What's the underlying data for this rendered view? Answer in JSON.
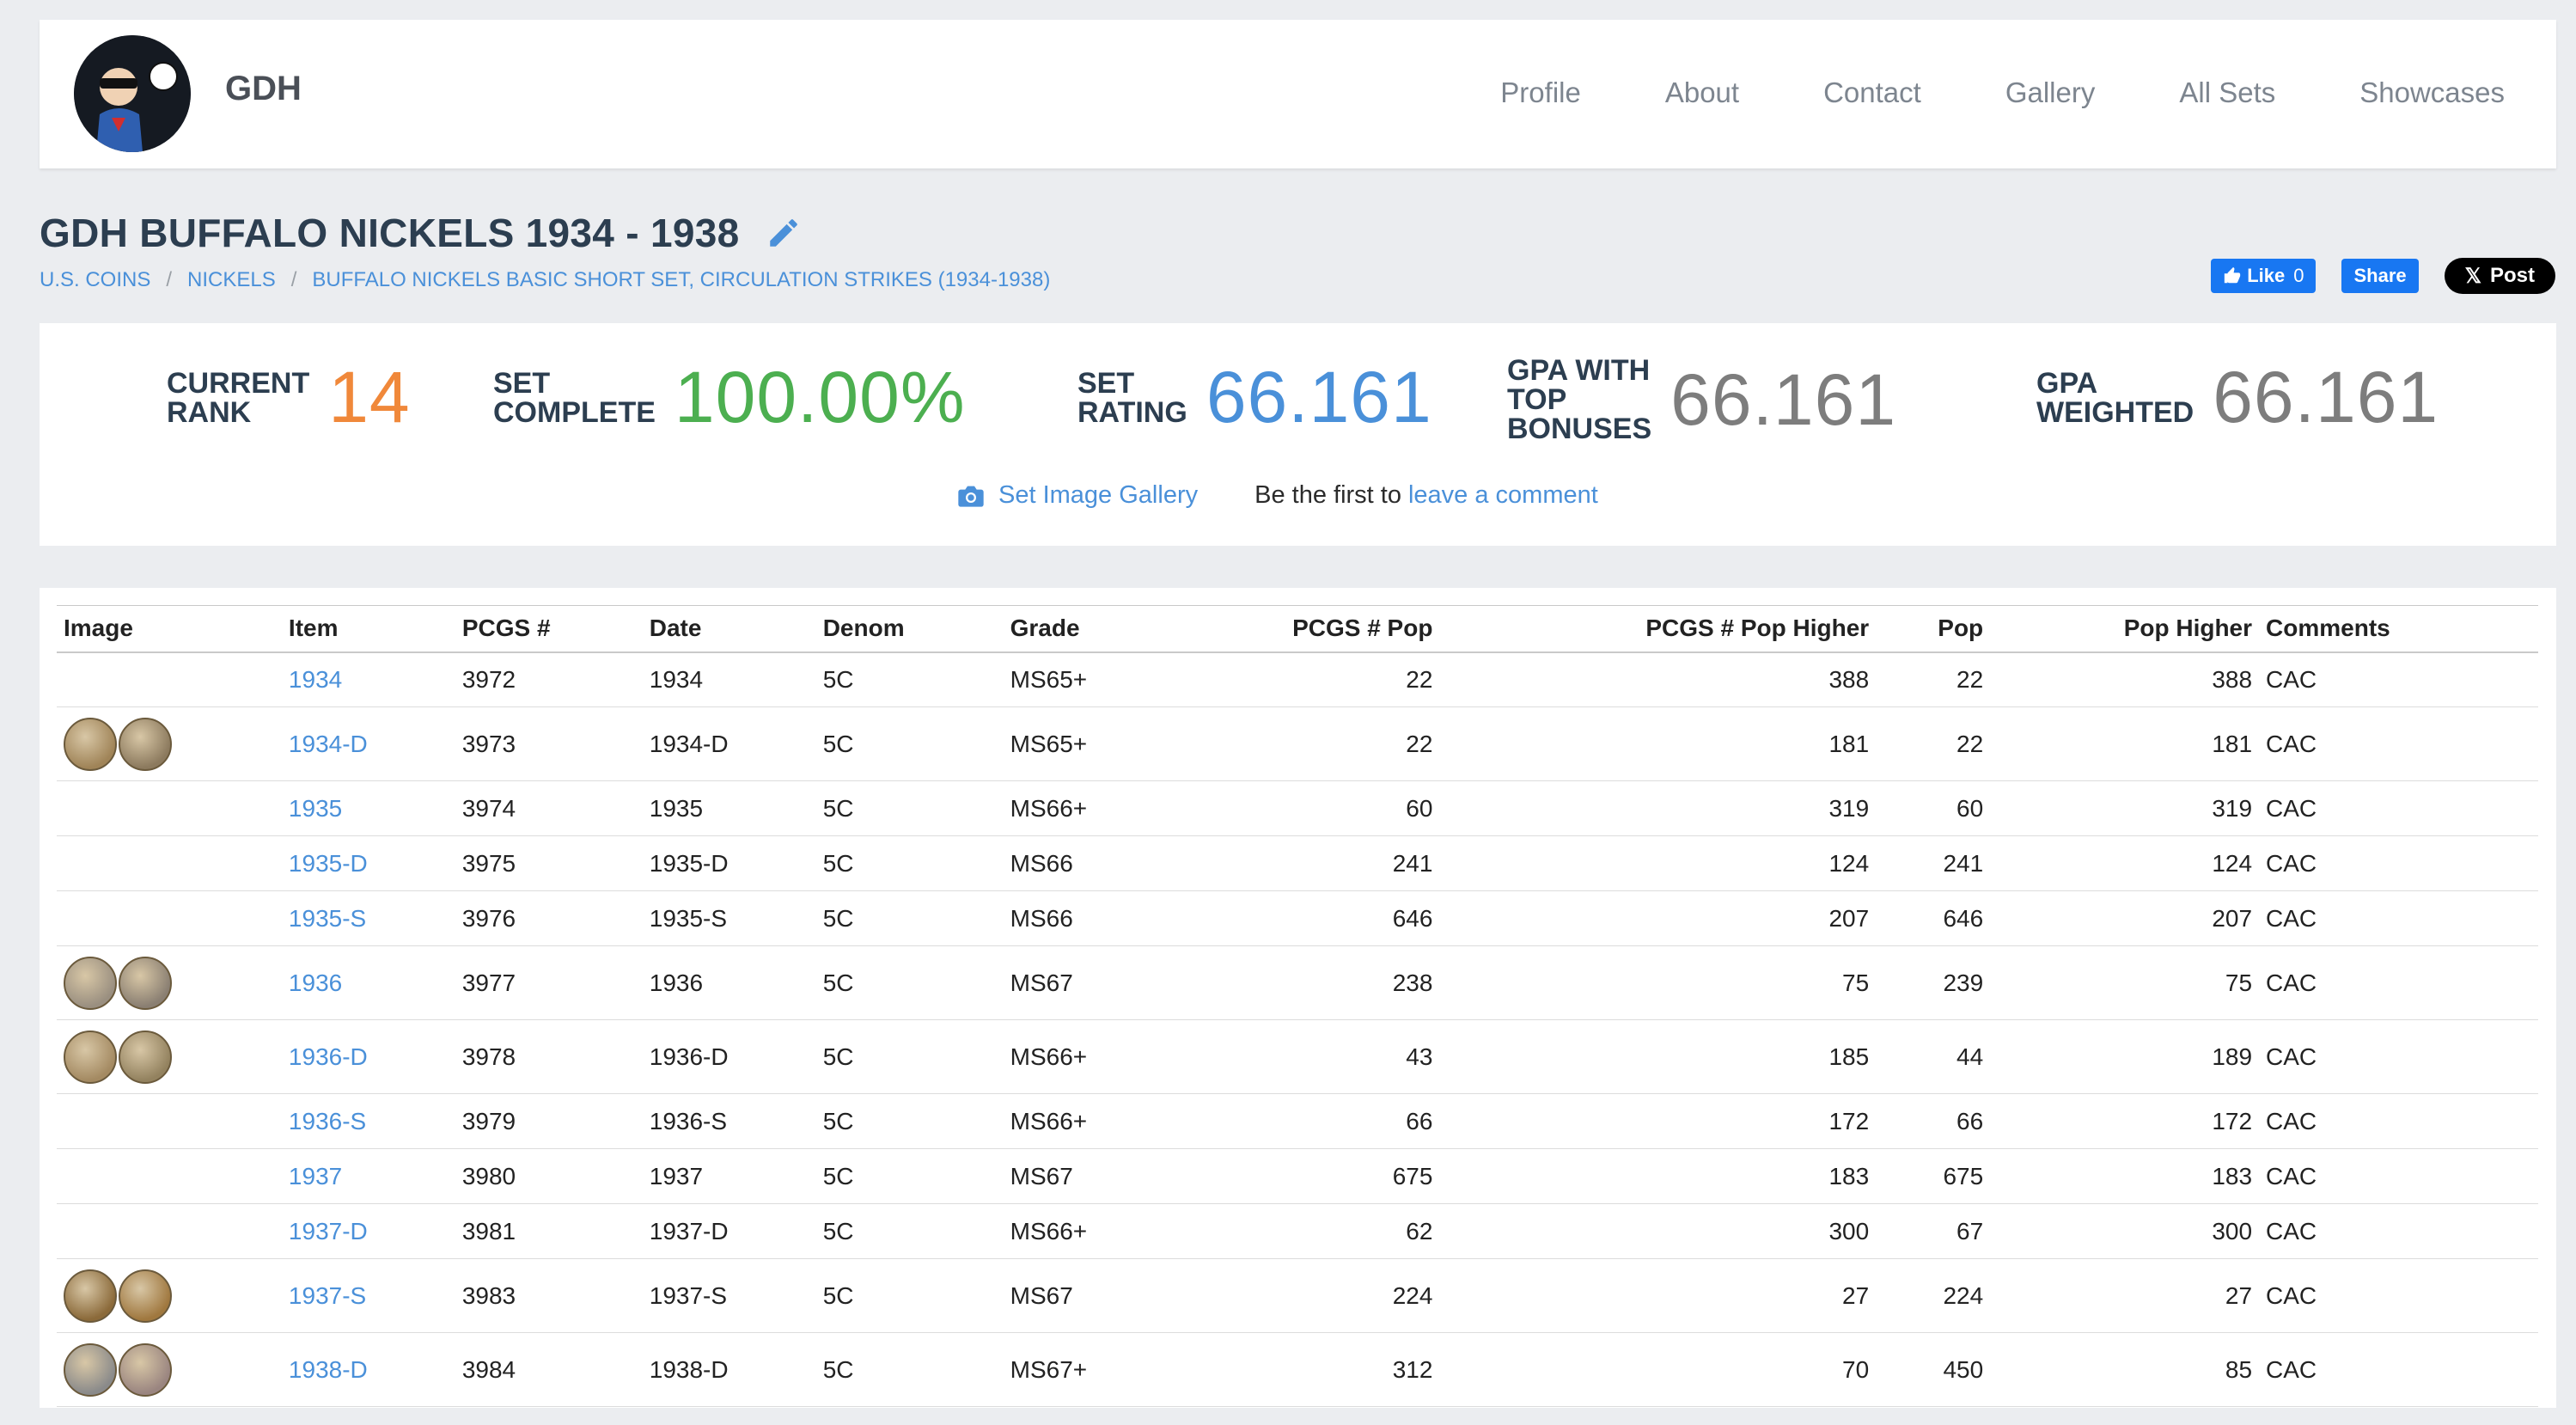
{
  "header": {
    "brand": "GDH",
    "nav": [
      "Profile",
      "About",
      "Contact",
      "Gallery",
      "All Sets",
      "Showcases"
    ]
  },
  "page": {
    "title": "GDH BUFFALO NICKELS 1934 - 1938",
    "breadcrumb": [
      "U.S. COINS",
      "NICKELS",
      "BUFFALO NICKELS BASIC SHORT SET, CIRCULATION STRIKES (1934-1938)"
    ]
  },
  "social": {
    "like": "Like",
    "like_count": "0",
    "share": "Share",
    "post": "Post"
  },
  "stats": {
    "rank_label": "CURRENT\nRANK",
    "rank_value": "14",
    "complete_label": "SET\nCOMPLETE",
    "complete_value": "100.00%",
    "rating_label": "SET\nRATING",
    "rating_value": "66.161",
    "gpa_bonus_label": "GPA WITH\nTOP BONUSES",
    "gpa_bonus_value": "66.161",
    "gpa_weighted_label": "GPA\nWEIGHTED",
    "gpa_weighted_value": "66.161"
  },
  "links": {
    "gallery": "Set Image Gallery",
    "first": "Be the first to",
    "comment": "leave a comment"
  },
  "colors": {
    "rank": "#f0883a",
    "complete": "#4caf50",
    "rating": "#4a90d9",
    "gpa": "#7d7d7d"
  },
  "table": {
    "headers": [
      "Image",
      "Item",
      "PCGS #",
      "Date",
      "Denom",
      "Grade",
      "PCGS # Pop",
      "PCGS # Pop Higher",
      "Pop",
      "Pop Higher",
      "Comments"
    ],
    "rows": [
      {
        "image": false,
        "item": "1934",
        "pcgs": "3972",
        "date": "1934",
        "denom": "5C",
        "grade": "MS65+",
        "pcgs_pop": "22",
        "pcgs_pop_higher": "388",
        "pop": "22",
        "pop_higher": "388",
        "comments": "CAC"
      },
      {
        "image": true,
        "item": "1934-D",
        "pcgs": "3973",
        "date": "1934-D",
        "denom": "5C",
        "grade": "MS65+",
        "pcgs_pop": "22",
        "pcgs_pop_higher": "181",
        "pop": "22",
        "pop_higher": "181",
        "comments": "CAC"
      },
      {
        "image": false,
        "item": "1935",
        "pcgs": "3974",
        "date": "1935",
        "denom": "5C",
        "grade": "MS66+",
        "pcgs_pop": "60",
        "pcgs_pop_higher": "319",
        "pop": "60",
        "pop_higher": "319",
        "comments": "CAC"
      },
      {
        "image": false,
        "item": "1935-D",
        "pcgs": "3975",
        "date": "1935-D",
        "denom": "5C",
        "grade": "MS66",
        "pcgs_pop": "241",
        "pcgs_pop_higher": "124",
        "pop": "241",
        "pop_higher": "124",
        "comments": "CAC"
      },
      {
        "image": false,
        "item": "1935-S",
        "pcgs": "3976",
        "date": "1935-S",
        "denom": "5C",
        "grade": "MS66",
        "pcgs_pop": "646",
        "pcgs_pop_higher": "207",
        "pop": "646",
        "pop_higher": "207",
        "comments": "CAC"
      },
      {
        "image": true,
        "item": "1936",
        "pcgs": "3977",
        "date": "1936",
        "denom": "5C",
        "grade": "MS67",
        "pcgs_pop": "238",
        "pcgs_pop_higher": "75",
        "pop": "239",
        "pop_higher": "75",
        "comments": "CAC"
      },
      {
        "image": true,
        "item": "1936-D",
        "pcgs": "3978",
        "date": "1936-D",
        "denom": "5C",
        "grade": "MS66+",
        "pcgs_pop": "43",
        "pcgs_pop_higher": "185",
        "pop": "44",
        "pop_higher": "189",
        "comments": "CAC"
      },
      {
        "image": false,
        "item": "1936-S",
        "pcgs": "3979",
        "date": "1936-S",
        "denom": "5C",
        "grade": "MS66+",
        "pcgs_pop": "66",
        "pcgs_pop_higher": "172",
        "pop": "66",
        "pop_higher": "172",
        "comments": "CAC"
      },
      {
        "image": false,
        "item": "1937",
        "pcgs": "3980",
        "date": "1937",
        "denom": "5C",
        "grade": "MS67",
        "pcgs_pop": "675",
        "pcgs_pop_higher": "183",
        "pop": "675",
        "pop_higher": "183",
        "comments": "CAC"
      },
      {
        "image": false,
        "item": "1937-D",
        "pcgs": "3981",
        "date": "1937-D",
        "denom": "5C",
        "grade": "MS66+",
        "pcgs_pop": "62",
        "pcgs_pop_higher": "300",
        "pop": "67",
        "pop_higher": "300",
        "comments": "CAC"
      },
      {
        "image": true,
        "item": "1937-S",
        "pcgs": "3983",
        "date": "1937-S",
        "denom": "5C",
        "grade": "MS67",
        "pcgs_pop": "224",
        "pcgs_pop_higher": "27",
        "pop": "224",
        "pop_higher": "27",
        "comments": "CAC"
      },
      {
        "image": true,
        "item": "1938-D",
        "pcgs": "3984",
        "date": "1938-D",
        "denom": "5C",
        "grade": "MS67+",
        "pcgs_pop": "312",
        "pcgs_pop_higher": "70",
        "pop": "450",
        "pop_higher": "85",
        "comments": "CAC"
      }
    ]
  }
}
